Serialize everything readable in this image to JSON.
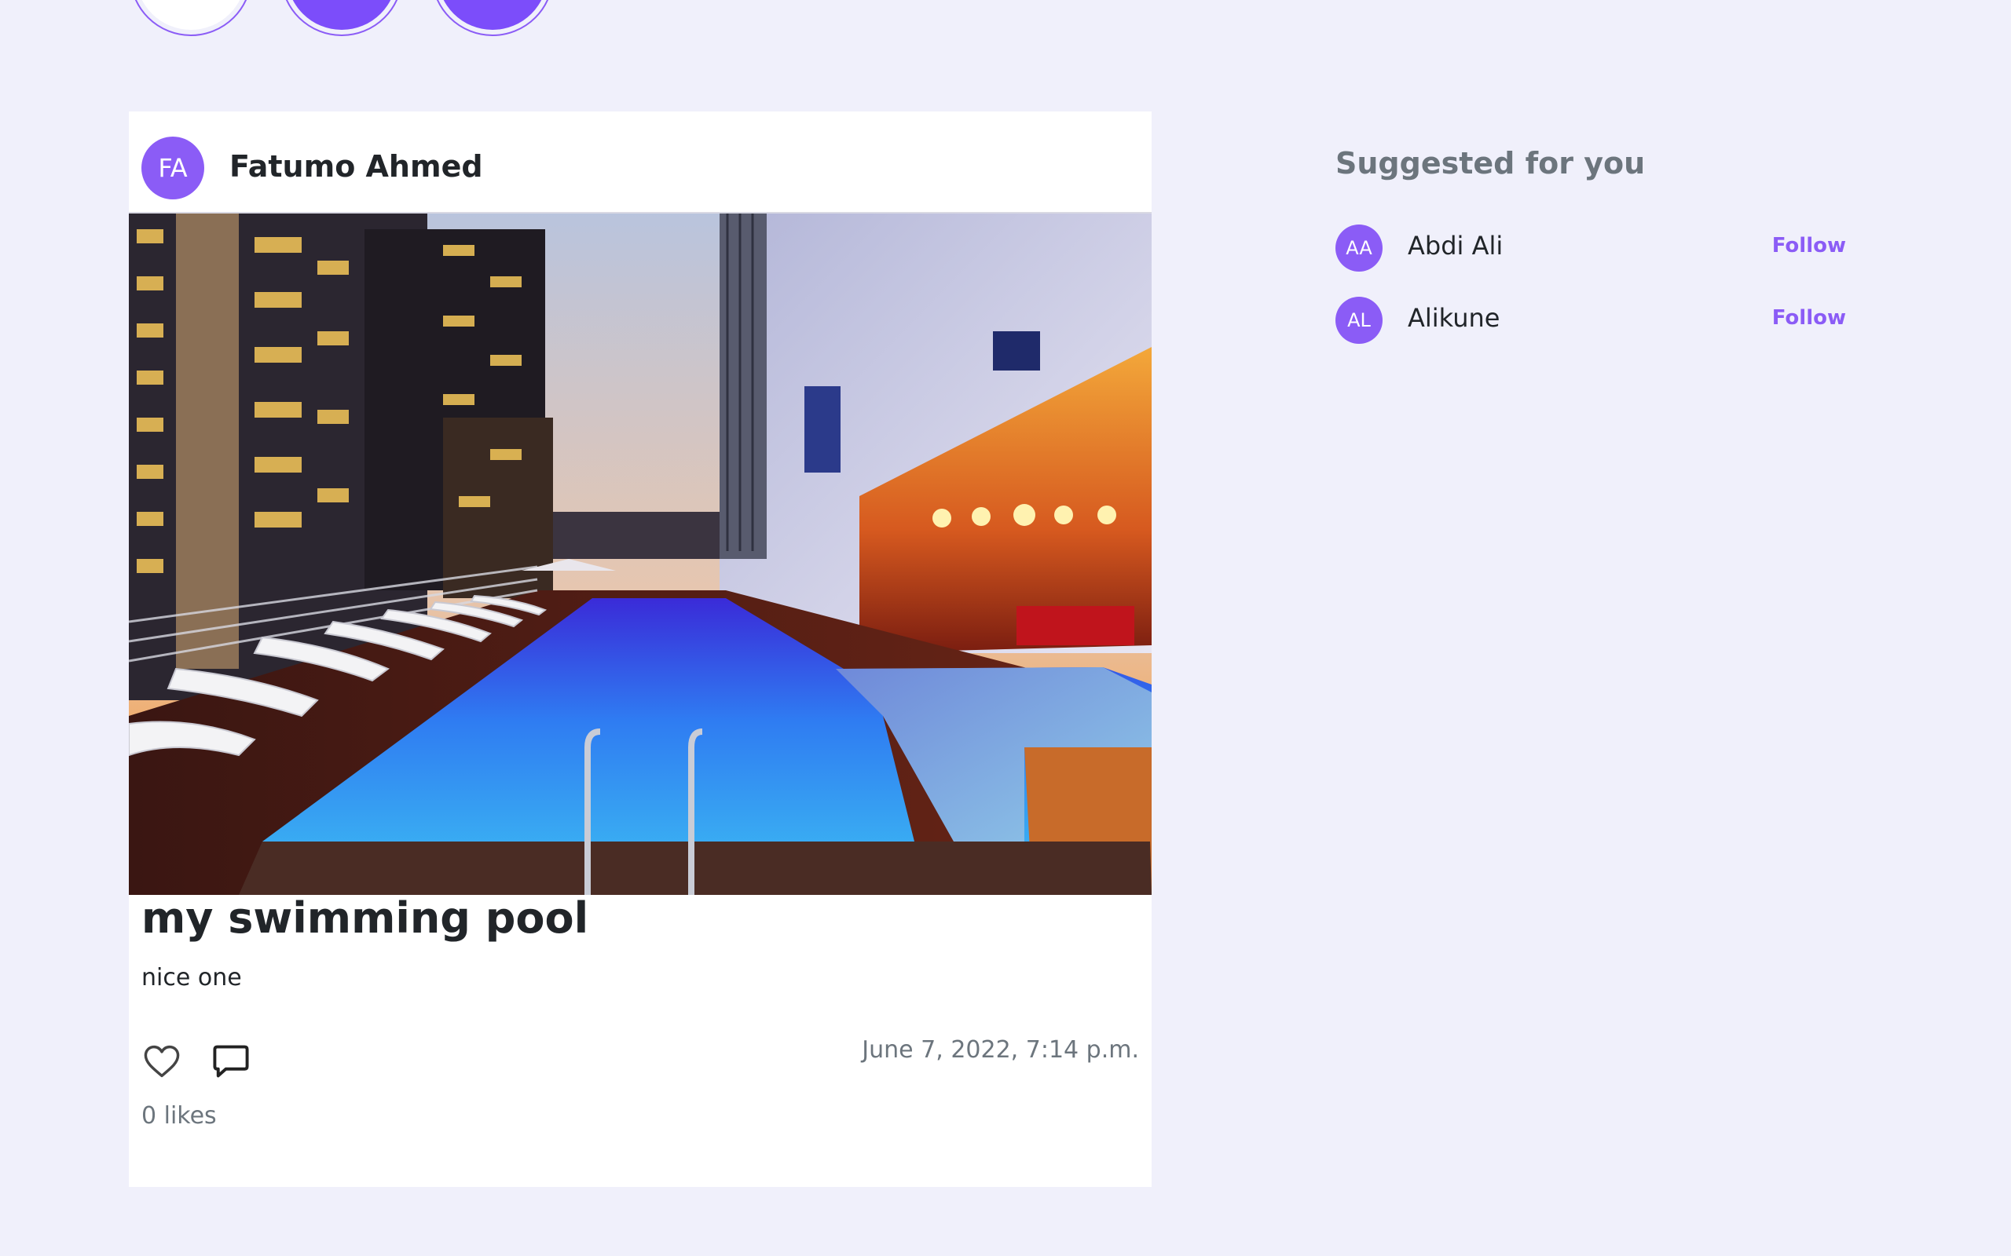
{
  "stories": [
    {
      "color": "#ffffff"
    },
    {
      "color": "#7c4dfa"
    },
    {
      "color": "#7c4dfa"
    }
  ],
  "post": {
    "author_initials": "FA",
    "author_name": "Fatumo Ahmed",
    "image_alt": "rooftop swimming pool at dusk",
    "title": "my swimming pool",
    "caption": "nice one",
    "date": "June 7, 2022, 7:14 p.m.",
    "likes": "0 likes",
    "like_icon": "heart-outline-icon",
    "comment_icon": "speech-bubble-icon"
  },
  "suggestions": {
    "title": "Suggested for you",
    "items": [
      {
        "initials": "AA",
        "name": "Abdi Ali",
        "action": "Follow"
      },
      {
        "initials": "AL",
        "name": "Alikune",
        "action": "Follow"
      }
    ]
  },
  "colors": {
    "accent": "#8b5cf6",
    "background": "#f0f0fb",
    "muted_text": "#6c757d"
  }
}
